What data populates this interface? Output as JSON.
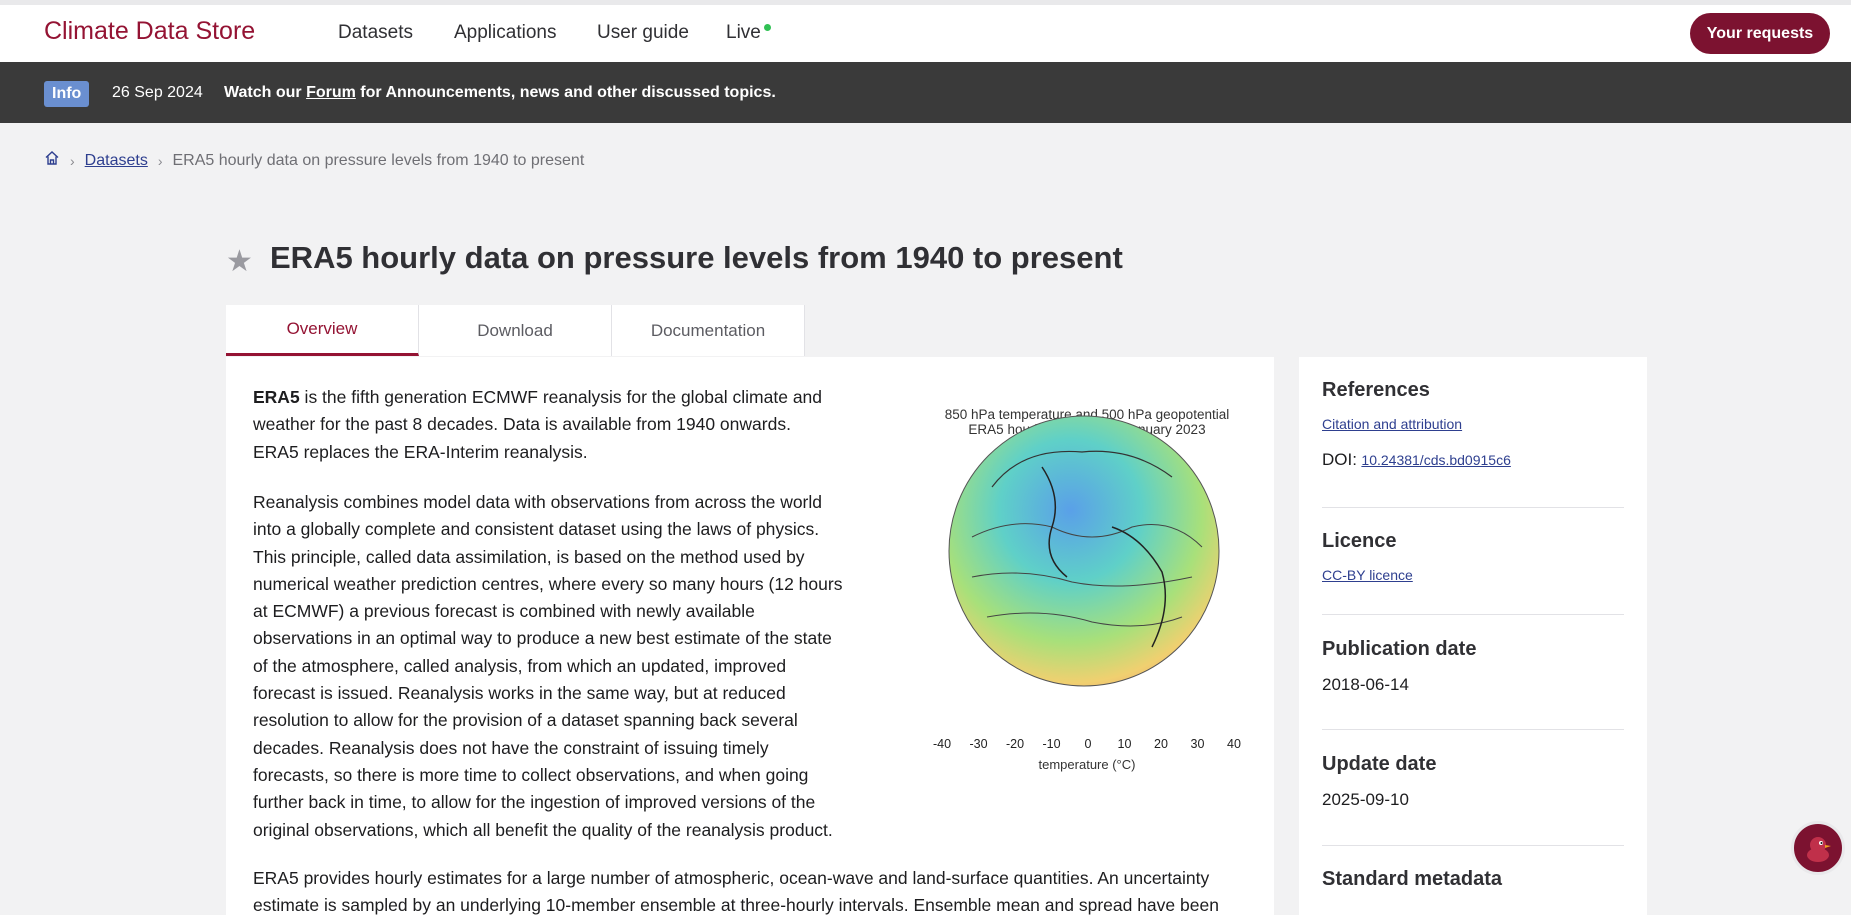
{
  "header": {
    "brand": "Climate Data Store",
    "nav": [
      "Datasets",
      "Applications",
      "User guide",
      "Live"
    ],
    "requests_label": "Your requests"
  },
  "infobar": {
    "badge": "Info",
    "date": "26 Sep 2024",
    "msg_pre": "Watch our ",
    "msg_link": "Forum",
    "msg_post": " for Announcements, news and other discussed topics."
  },
  "breadcrumb": {
    "home_icon": "home-icon",
    "datasets": "Datasets",
    "current": "ERA5 hourly data on pressure levels from 1940 to present"
  },
  "page_title": "ERA5 hourly data on pressure levels from 1940 to present",
  "tabs": [
    "Overview",
    "Download",
    "Documentation"
  ],
  "content": {
    "p1_bold": "ERA5",
    "p1_rest": " is the fifth generation ECMWF reanalysis for the global climate and weather for the past 8 decades. Data is available from 1940 onwards. ERA5 replaces the ERA-Interim reanalysis.",
    "p2": "Reanalysis combines model data with observations from across the world into a globally complete and consistent dataset using the laws of physics. This principle, called data assimilation, is based on the method used by numerical weather prediction centres, where every so many hours (12 hours at ECMWF) a previous forecast is combined with newly available observations in an optimal way to produce a new best estimate of the state of the atmosphere, called analysis, from which an updated, improved forecast is issued. Reanalysis works in the same way, but at reduced resolution to allow for the provision of a dataset spanning back several decades. Reanalysis does not have the constraint of issuing timely forecasts, so there is more time to collect observations, and when going further back in time, to allow for the ingestion of improved versions of the original observations, which all benefit the quality of the reanalysis product.",
    "p3": "ERA5 provides hourly estimates for a large number of atmospheric, ocean-wave and land-surface quantities. An uncertainty estimate is sampled by an underlying 10-member ensemble at three-hourly intervals. Ensemble mean and spread have been"
  },
  "figure": {
    "title_line1": "850 hPa temperature and 500 hPa geopotential",
    "title_line2": "ERA5 hourly - 00:00 on 1 January 2023",
    "colorbar_ticks": [
      "-40",
      "-30",
      "-20",
      "-10",
      "0",
      "10",
      "20",
      "30",
      "40"
    ],
    "colorbar_label": "temperature (°C)"
  },
  "sidebar": {
    "references_title": "References",
    "citation_link": "Citation and attribution",
    "doi_label": "DOI:",
    "doi_link": "10.24381/cds.bd0915c6",
    "licence_title": "Licence",
    "licence_link": "CC-BY licence",
    "pubdate_title": "Publication date",
    "pubdate": "2018-06-14",
    "update_title": "Update date",
    "update": "2025-09-10",
    "metadata_title": "Standard metadata"
  }
}
